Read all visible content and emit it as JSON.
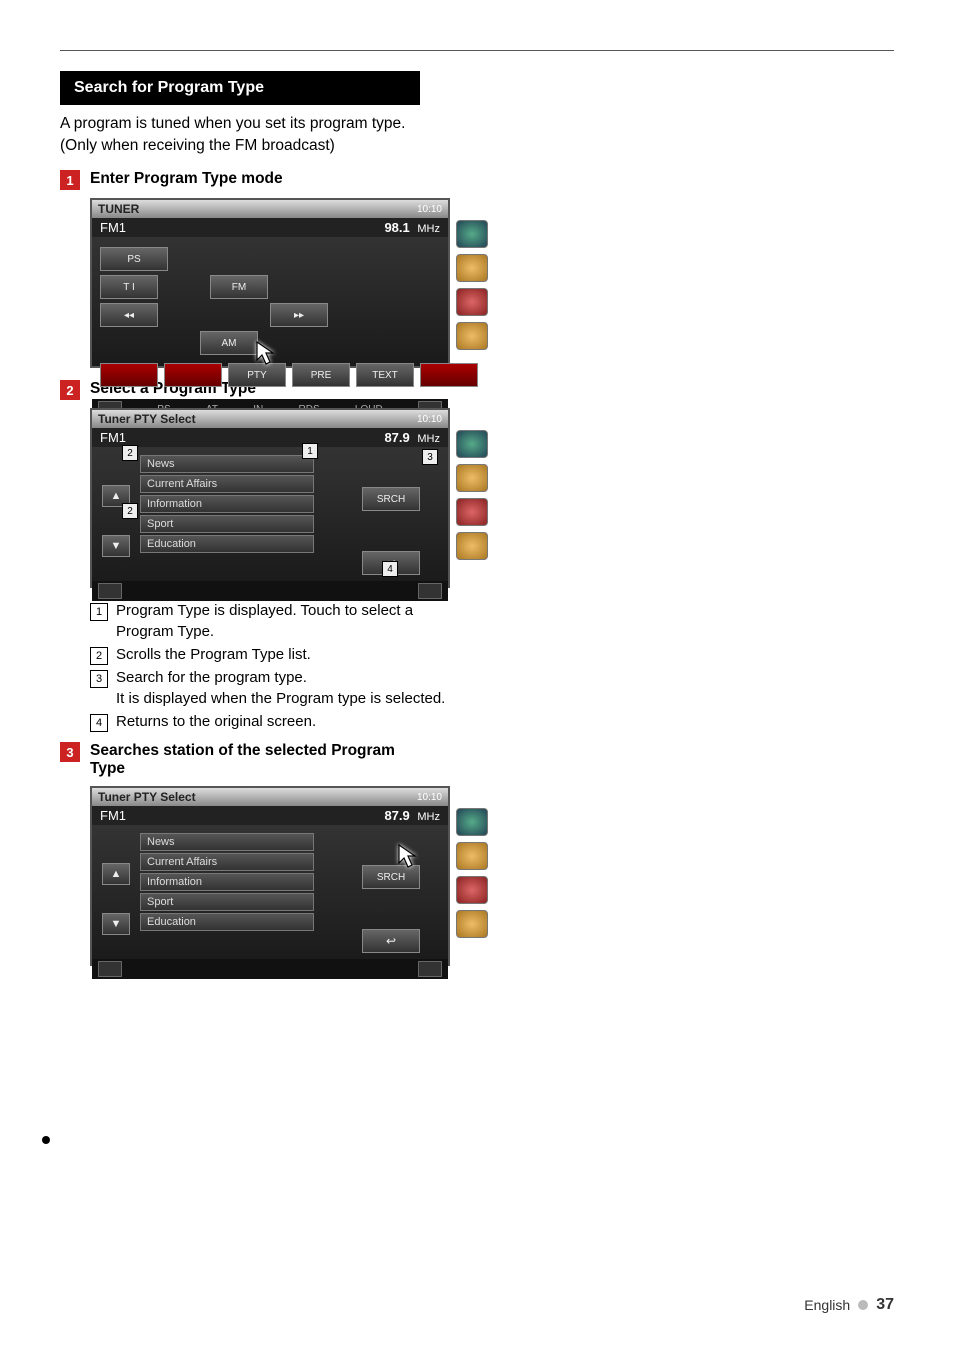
{
  "page": {
    "language_label": "English",
    "number": "37"
  },
  "section": {
    "title": "Search for Program Type",
    "intro": "A program is tuned when you set its program type. (Only when receiving the FM broadcast)"
  },
  "steps": {
    "s1": {
      "num": "1",
      "title": "Enter Program Type mode"
    },
    "s2": {
      "num": "2",
      "title": "Select a Program Type"
    },
    "s3": {
      "num": "3",
      "title": "Searches station of the selected Program Type"
    }
  },
  "tuner": {
    "title": "TUNER",
    "band": "FM1",
    "freq": "98.1",
    "unit": "MHz",
    "clock": "10:10",
    "btn_ps": "PS",
    "btn_ti": "T I",
    "btn_fm": "FM",
    "btn_am": "AM",
    "btn_prev": "◂◂",
    "btn_next": "▸▸",
    "btn_pty": "PTY",
    "btn_pre": "PRE",
    "btn_text": "TEXT",
    "label_in": "IN",
    "label_rds": "RDS",
    "label_loud": "LOUD",
    "label_ps2": "PS",
    "label_at": "AT"
  },
  "pty": {
    "title": "Tuner PTY Select",
    "band": "FM1",
    "freq": "87.9",
    "unit": "MHz",
    "clock": "10:10",
    "up": "▲",
    "down": "▼",
    "srch": "SRCH",
    "return": "↩",
    "items": {
      "i0": "News",
      "i1": "Current Affairs",
      "i2": "Information",
      "i3": "Sport",
      "i4": "Education"
    }
  },
  "notes": {
    "n1": "Program Type is displayed. Touch to select a Program Type.",
    "n2": "Scrolls the Program Type list.",
    "n3": "Search for the program type.\nIt is displayed when the Program type is selected.",
    "n4": "Returns to the original screen."
  }
}
